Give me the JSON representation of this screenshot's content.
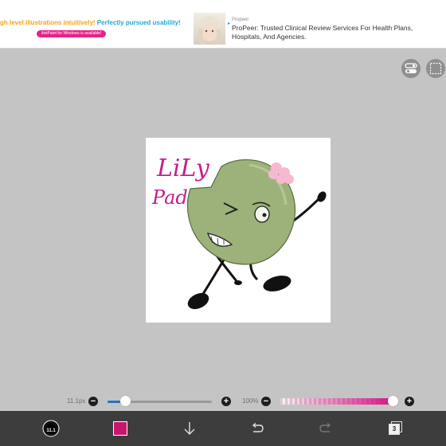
{
  "ad": {
    "headline_orange": "gh level illustrations intuitively!",
    "headline_blue": " Perfectly pursued usability!",
    "pill_text": "ibisPaint for Windows is available!",
    "brand": "Propeer",
    "description": "ProPeer: Trusted Clinical Review Services For Health Plans, Hospitals, And Agencies.",
    "choices_icon": "ad-choices-icon"
  },
  "artwork": {
    "handwriting": [
      "LiLy",
      "Pad"
    ],
    "character": "lily-pad-character",
    "ink_color": "#c2208b"
  },
  "top_tools": [
    {
      "icon": "layer-toggle-icon"
    },
    {
      "icon": "selection-icon"
    }
  ],
  "brush_size": {
    "label": "11.1px",
    "minus": "−",
    "plus": "+",
    "level": 0.17
  },
  "opacity": {
    "label": "100%",
    "minus": "−",
    "plus": "+",
    "level": 1.0
  },
  "toolbar": {
    "brush_size_text": "11.1",
    "color": "#c8156e",
    "layer_count": "3",
    "items": [
      "brush-size-icon",
      "color-swatch",
      "download-arrow-icon",
      "undo-icon",
      "redo-icon",
      "layers-icon"
    ]
  }
}
